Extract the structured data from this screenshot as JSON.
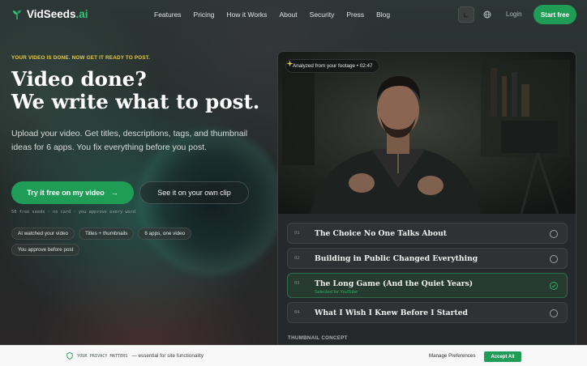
{
  "nav": {
    "logo_main": "VidSeeds",
    "logo_suffix": ".ai",
    "links": [
      "Features",
      "Pricing",
      "How it Works",
      "About",
      "Security",
      "Press",
      "Blog"
    ],
    "login": "Login",
    "start": "Start free"
  },
  "hero": {
    "eyebrow": "YOUR VIDEO IS DONE. NOW GET IT READY TO POST.",
    "headline_line1": "Video done?",
    "headline_line2": "We write what to post.",
    "subtext": "Upload your video. Get titles, descriptions, tags, and thumbnail ideas for 6 apps. You fix everything before you post.",
    "cta_primary": "Try it free on my video",
    "cta_primary_arrow": "→",
    "cta_secondary": "See it on your own clip",
    "fineprint": "50 free seeds · no card · you approve every word",
    "chips": [
      "AI watched your video",
      "Titles + thumbnails",
      "6 apps, one video",
      "You approve before post"
    ]
  },
  "panel": {
    "analyzed": "Analyzed from your footage • 02:47",
    "titles": [
      {
        "num": "01",
        "text": "The Choice No One Talks About",
        "selected": false
      },
      {
        "num": "02",
        "text": "Building in Public Changed Everything",
        "selected": false
      },
      {
        "num": "03",
        "text": "The Long Game (And the Quiet Years)",
        "selected": true,
        "sub": "Selected for YouTube"
      },
      {
        "num": "04",
        "text": "What I Wish I Knew Before I Started",
        "selected": false
      }
    ],
    "thumbnail_label": "THUMBNAIL CONCEPT"
  },
  "cookie": {
    "tag": "YOUR PRIVACY MATTERS",
    "text": "— essential for site functionality",
    "manage": "Manage Preferences",
    "accept": "Accept All"
  },
  "colors": {
    "accent": "#1f9d57",
    "eyebrow": "#e6c84a",
    "background": "#232927"
  },
  "icons": [
    "seed-logo-icon",
    "moon-icon",
    "globe-icon",
    "arrow-right-icon",
    "sparkle-icon",
    "radio-icon",
    "check-icon",
    "shield-icon"
  ]
}
